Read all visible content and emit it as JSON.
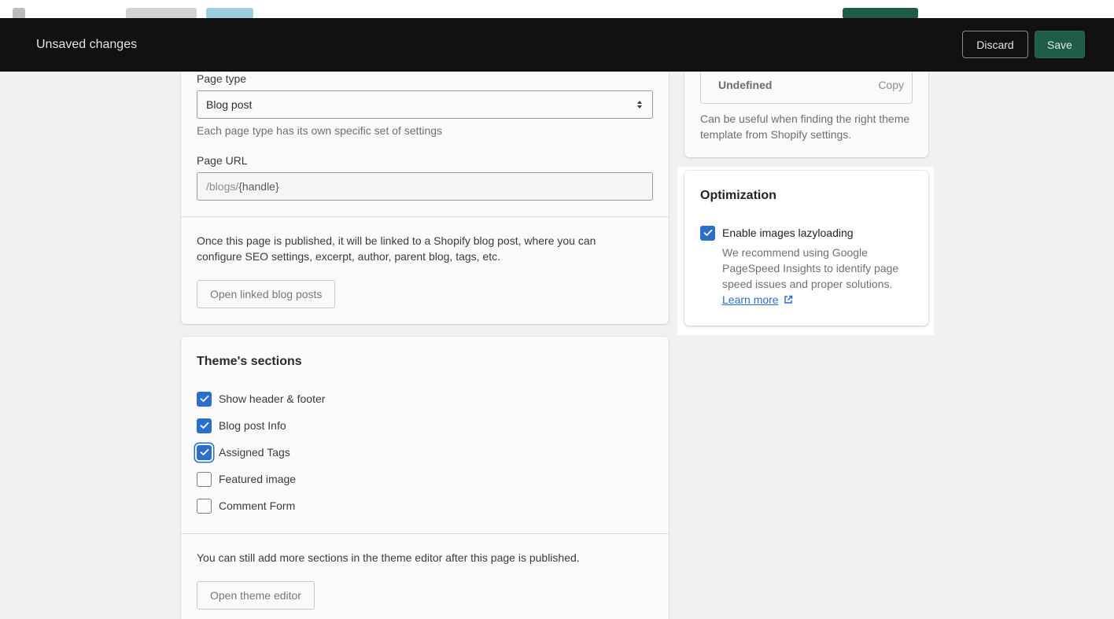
{
  "save_bar": {
    "message": "Unsaved changes",
    "discard_label": "Discard",
    "save_label": "Save"
  },
  "page_type": {
    "label": "Page type",
    "value": "Blog post",
    "help": "Each page type has its own specific set of settings"
  },
  "page_url": {
    "label": "Page URL",
    "prefix": "/blogs/",
    "value": "{handle}"
  },
  "blog_info": {
    "text": "Once this page is published, it will be linked to a Shopify blog post, where you can configure SEO settings, excerpt, author, parent blog, tags, etc.",
    "button_label": "Open linked blog posts"
  },
  "theme_sections": {
    "title": "Theme's sections",
    "items": [
      {
        "label": "Show header & footer",
        "checked": true
      },
      {
        "label": "Blog post Info",
        "checked": true
      },
      {
        "label": "Assigned Tags",
        "checked": true
      },
      {
        "label": "Featured image",
        "checked": false
      },
      {
        "label": "Comment Form",
        "checked": false
      }
    ],
    "footer_text": "You can still add more sections in the theme editor after this page is published.",
    "button_label": "Open theme editor"
  },
  "template_card": {
    "value": "Undefined",
    "copy_label": "Copy",
    "help": "Can be useful when finding the right theme template from Shopify settings."
  },
  "optimization": {
    "title": "Optimization",
    "checkbox_label": "Enable images lazyloading",
    "checked": true,
    "description": "We recommend using Google PageSpeed Insights to identify page speed issues and proper solutions.",
    "link_label": "Learn more"
  }
}
